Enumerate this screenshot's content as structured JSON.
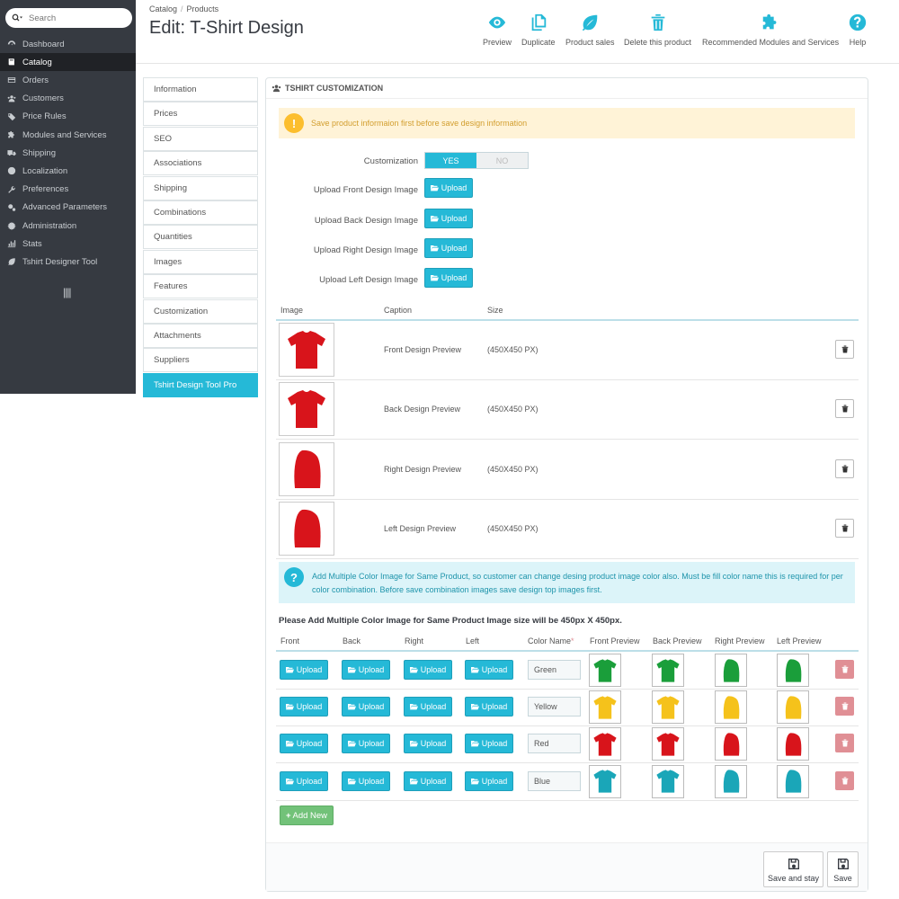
{
  "search": {
    "placeholder": "Search"
  },
  "sidebar": {
    "items": [
      {
        "label": "Dashboard",
        "icon": "dashboard-icon"
      },
      {
        "label": "Catalog",
        "icon": "book-icon",
        "active": true
      },
      {
        "label": "Orders",
        "icon": "credit-card-icon"
      },
      {
        "label": "Customers",
        "icon": "users-icon"
      },
      {
        "label": "Price Rules",
        "icon": "tags-icon"
      },
      {
        "label": "Modules and Services",
        "icon": "puzzle-icon"
      },
      {
        "label": "Shipping",
        "icon": "truck-icon"
      },
      {
        "label": "Localization",
        "icon": "globe-icon"
      },
      {
        "label": "Preferences",
        "icon": "wrench-icon"
      },
      {
        "label": "Advanced Parameters",
        "icon": "cogs-icon"
      },
      {
        "label": "Administration",
        "icon": "gear-icon"
      },
      {
        "label": "Stats",
        "icon": "bar-chart-icon"
      },
      {
        "label": "Tshirt Designer Tool",
        "icon": "leaf-icon"
      }
    ]
  },
  "breadcrumb": {
    "catalog": "Catalog",
    "sep": "/",
    "products": "Products"
  },
  "page": {
    "title": "Edit: T-Shirt Design"
  },
  "toolbar": {
    "preview": "Preview",
    "duplicate": "Duplicate",
    "product_sales": "Product sales",
    "delete": "Delete this product",
    "recommended": "Recommended Modules and Services",
    "help": "Help"
  },
  "tabs": [
    "Information",
    "Prices",
    "SEO",
    "Associations",
    "Shipping",
    "Combinations",
    "Quantities",
    "Images",
    "Features",
    "Customization",
    "Attachments",
    "Suppliers",
    "Tshirt Design Tool Pro"
  ],
  "panel": {
    "heading": "TSHIRT CUSTOMIZATION",
    "warning": "Save product informaion first before save design information",
    "customization_label": "Customization",
    "yes": "YES",
    "no": "NO",
    "upload_label": "Upload",
    "upload_front": "Upload Front Design Image",
    "upload_back": "Upload Back Design Image",
    "upload_right": "Upload Right Design Image",
    "upload_left": "Upload Left Design Image"
  },
  "image_table": {
    "headers": {
      "image": "Image",
      "caption": "Caption",
      "size": "Size"
    },
    "rows": [
      {
        "caption": "Front Design Preview",
        "size": "(450X450 PX)"
      },
      {
        "caption": "Back Design Preview",
        "size": "(450X450 PX)"
      },
      {
        "caption": "Right Design Preview",
        "size": "(450X450 PX)"
      },
      {
        "caption": "Left Design Preview",
        "size": "(450X450 PX)"
      }
    ]
  },
  "info": {
    "text": "Add Multiple Color Image for Same Product, so customer can change desing product image color also. Must be fill color name this is required for per color combination. Before save combination images save design top images first."
  },
  "color_table": {
    "heading": "Please Add Multiple Color Image for Same Product Image size will be 450px X 450px.",
    "headers": {
      "front": "Front",
      "back": "Back",
      "right": "Right",
      "left": "Left",
      "color_name": "Color Name",
      "required_mark": "*",
      "front_preview": "Front Preview",
      "back_preview": "Back Preview",
      "right_preview": "Right Preview",
      "left_preview": "Left Preview"
    },
    "rows": [
      {
        "name": "Green",
        "color": "#1a9e3a"
      },
      {
        "name": "Yellow",
        "color": "#f5c21b"
      },
      {
        "name": "Red",
        "color": "#d8141b"
      },
      {
        "name": "Blue",
        "color": "#1aa6b8"
      }
    ]
  },
  "buttons": {
    "add_new": "Add New",
    "save_and_stay": "Save and stay",
    "save": "Save"
  },
  "colors": {
    "accent": "#25b9d7",
    "sidebar": "#363a41",
    "tshirt_red": "#d8141b",
    "success": "#72c279",
    "danger": "#e08f95"
  }
}
